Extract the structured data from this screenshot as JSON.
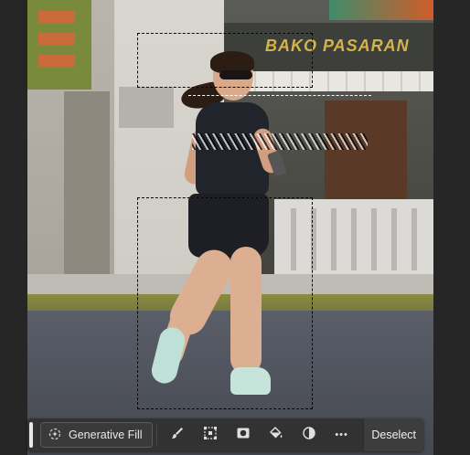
{
  "canvas": {
    "storefront_sign_text": "BAKO PASARAN"
  },
  "taskbar": {
    "generative_fill_label": "Generative Fill",
    "more_label": "•••",
    "deselect_label": "Deselect",
    "icons": [
      "sparkle-icon",
      "brush-icon",
      "transform-selection-icon",
      "mask-icon",
      "fill-bucket-icon",
      "adjustment-icon",
      "more-icon"
    ]
  },
  "colors": {
    "app_background": "#262626",
    "taskbar_background": "#323232",
    "text": "#e8e8e8"
  }
}
